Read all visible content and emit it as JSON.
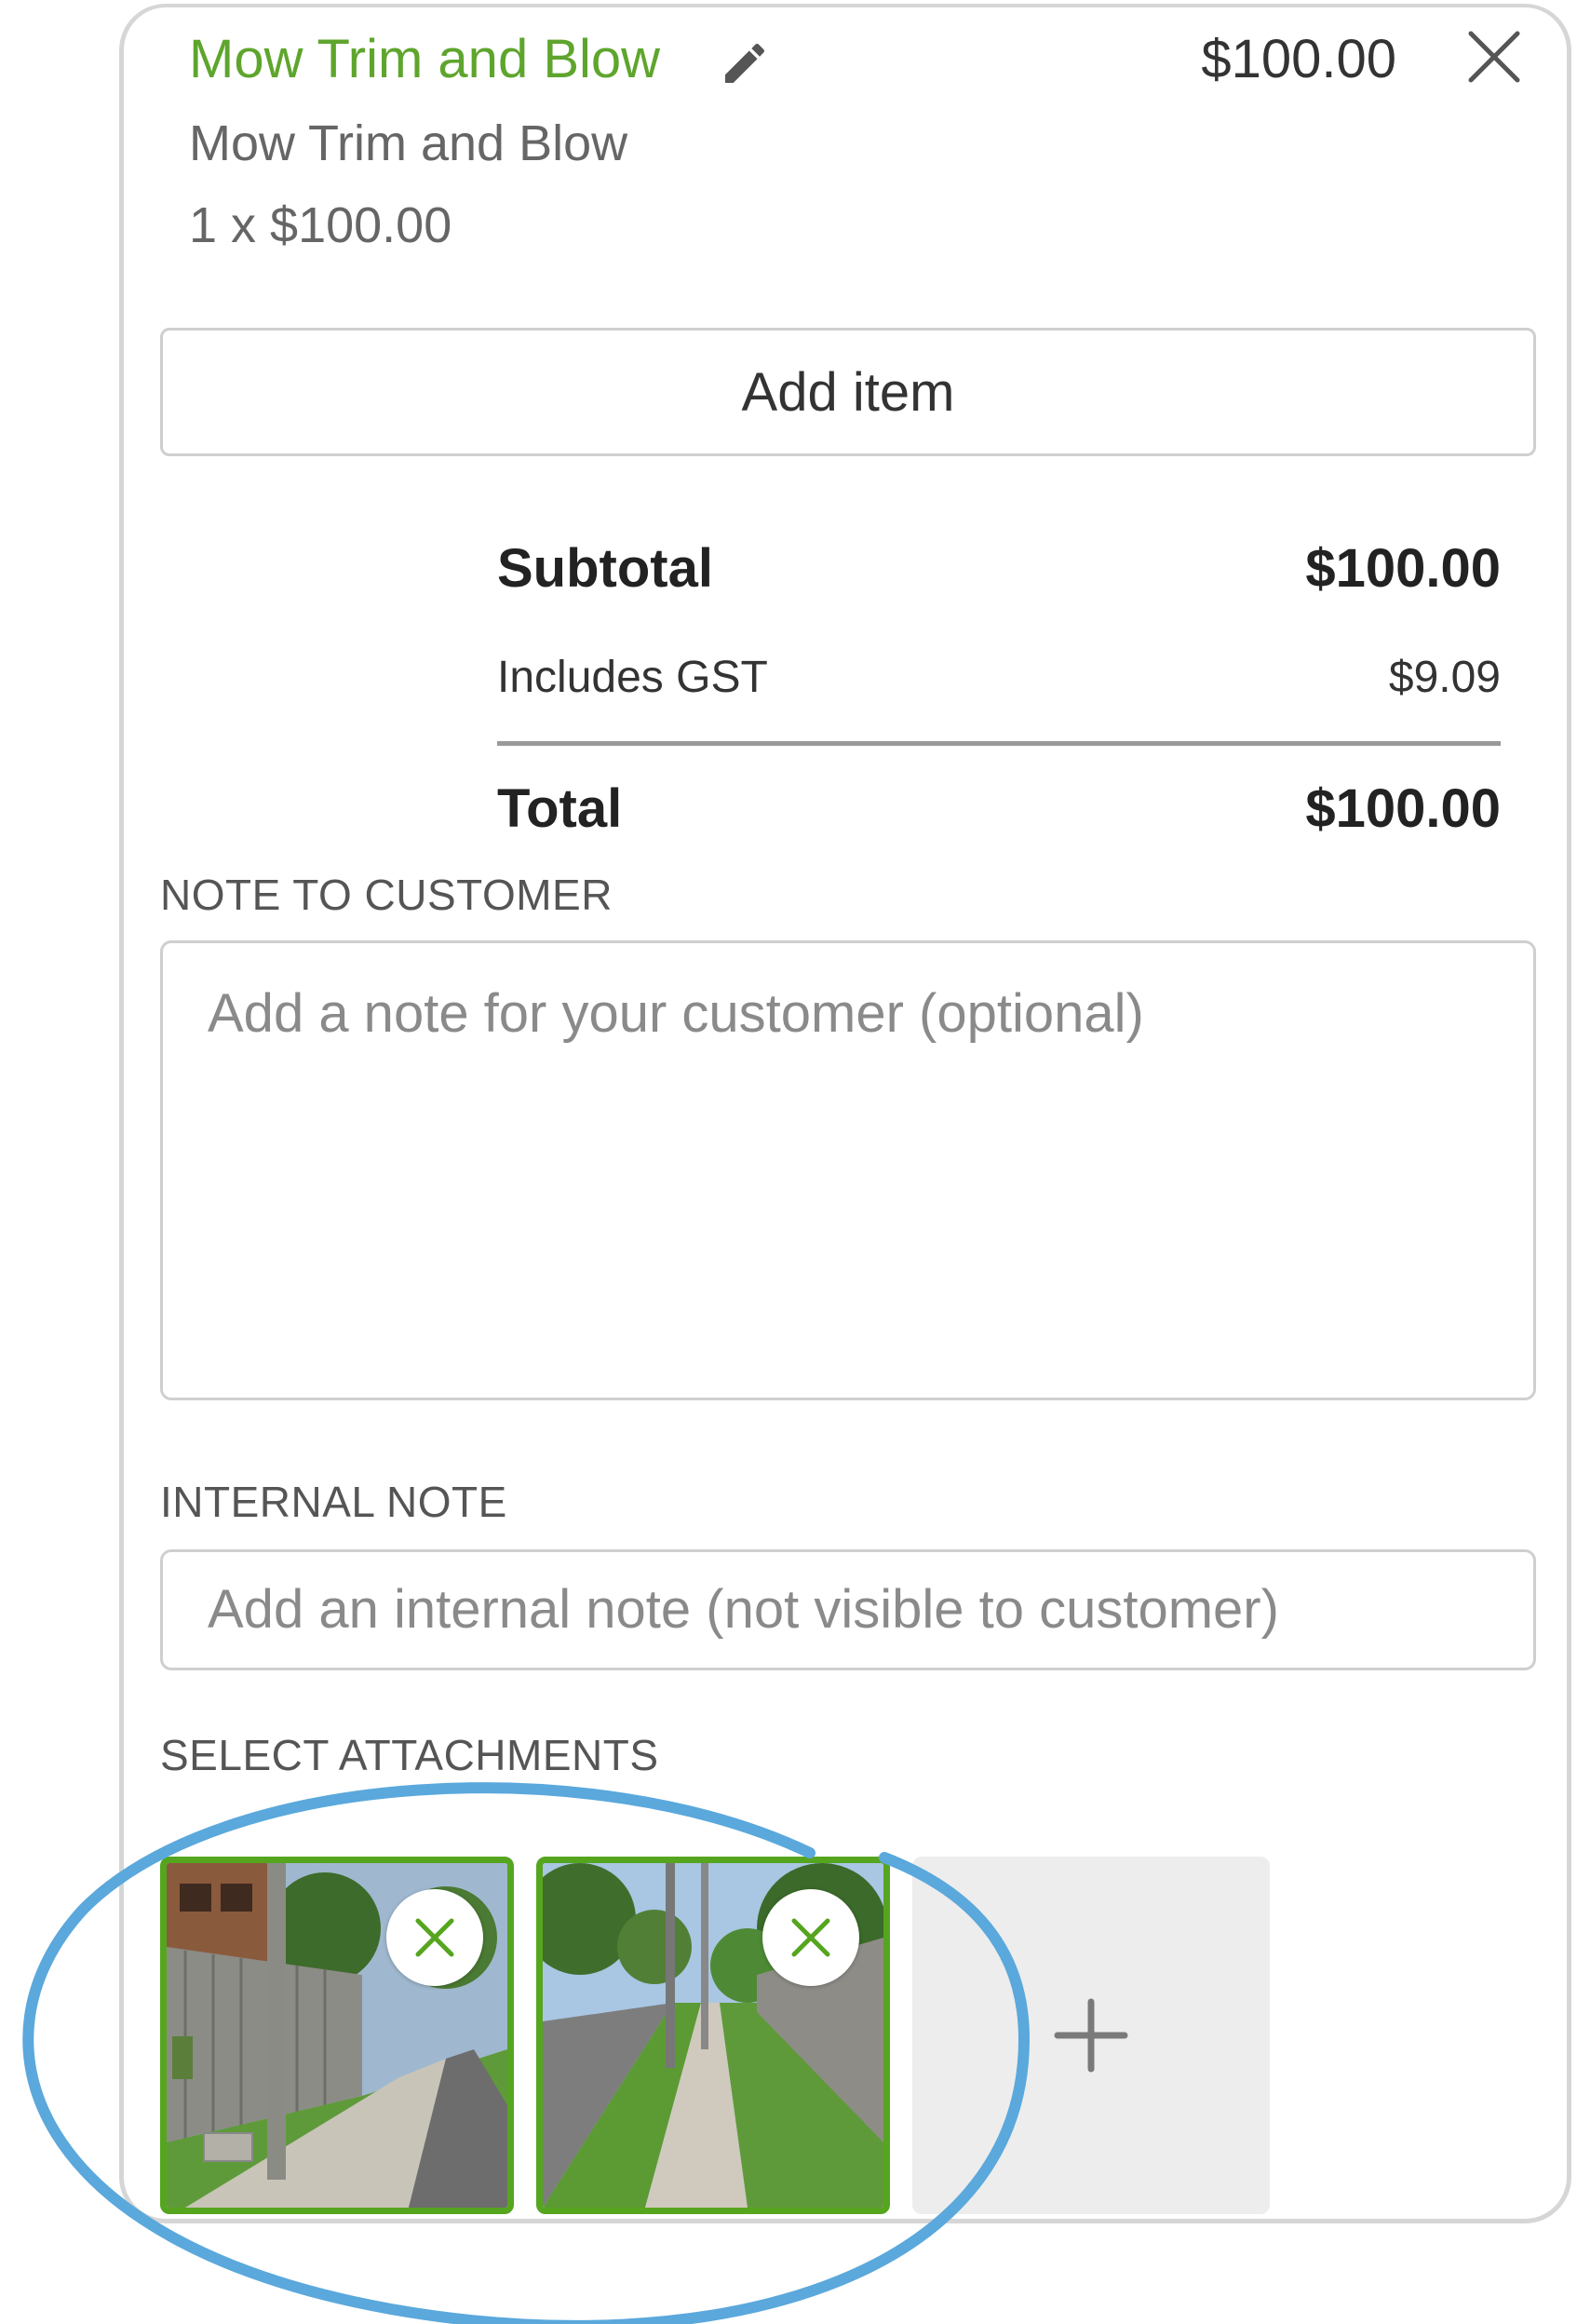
{
  "line_item": {
    "title": "Mow Trim and Blow",
    "price": "$100.00",
    "description": "Mow Trim and Blow",
    "quantity_line": "1 x $100.00"
  },
  "actions": {
    "add_item_label": "Add item"
  },
  "summary": {
    "subtotal_label": "Subtotal",
    "subtotal_value": "$100.00",
    "gst_label": "Includes GST",
    "gst_value": "$9.09",
    "total_label": "Total",
    "total_value": "$100.00"
  },
  "note_to_customer": {
    "label": "NOTE TO CUSTOMER",
    "placeholder": "Add a note for your customer (optional)"
  },
  "internal_note": {
    "label": "INTERNAL NOTE",
    "placeholder": "Add an internal note (not visible to customer)"
  },
  "attachments": {
    "label": "SELECT ATTACHMENTS",
    "items": [
      {
        "selected": true
      },
      {
        "selected": true
      }
    ]
  },
  "colors": {
    "accent_green": "#5ea52d",
    "selected_border": "#56a51f",
    "annotation_blue": "#5aa8dc"
  },
  "icons": {
    "edit": "pencil-icon",
    "close": "close-icon",
    "remove_attachment": "close-icon",
    "add_attachment": "plus-icon"
  }
}
